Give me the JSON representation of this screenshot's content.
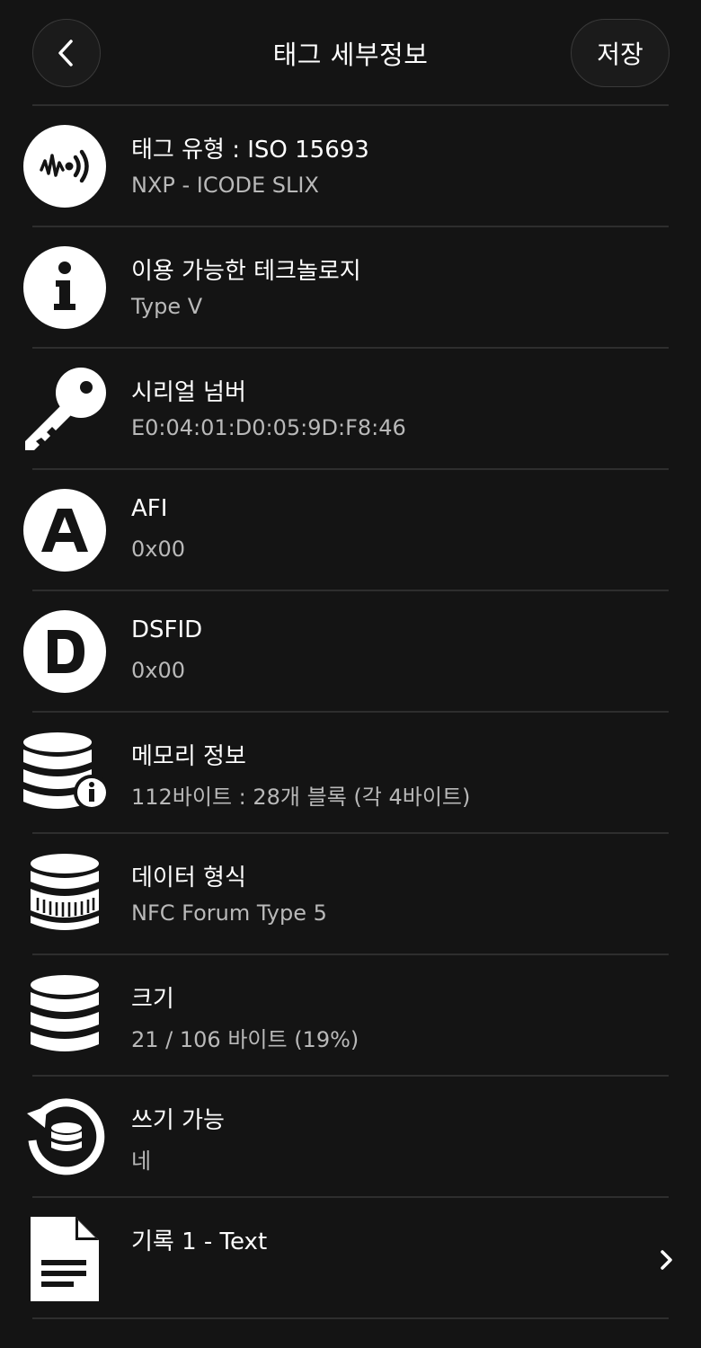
{
  "header": {
    "title": "태그 세부정보",
    "save_label": "저장",
    "back_icon": "chevron-left-icon"
  },
  "rows": [
    {
      "icon": "nfc-wave-icon",
      "title": "태그 유형 : ISO 15693",
      "value": "NXP - ICODE SLIX"
    },
    {
      "icon": "info-icon",
      "title": "이용 가능한 테크놀로지",
      "value": "Type V"
    },
    {
      "icon": "key-icon",
      "title": "시리얼 넘버",
      "value": "E0:04:01:D0:05:9D:F8:46"
    },
    {
      "icon": "letter-a-icon",
      "title": "AFI",
      "value": "0x00"
    },
    {
      "icon": "letter-d-icon",
      "title": "DSFID",
      "value": "0x00"
    },
    {
      "icon": "database-info-icon",
      "title": "메모리 정보",
      "value": "112바이트 : 28개 블록 (각 4바이트)"
    },
    {
      "icon": "database-format-icon",
      "title": "데이터 형식",
      "value": "NFC Forum Type 5"
    },
    {
      "icon": "database-icon",
      "title": "크기",
      "value": "21 / 106 바이트 (19%)"
    },
    {
      "icon": "rewrite-database-icon",
      "title": "쓰기 가능",
      "value": "네"
    },
    {
      "icon": "document-icon",
      "title": "기록 1 - Text",
      "value": "",
      "chevron_icon": "chevron-right-icon"
    }
  ],
  "colors": {
    "background": "#141414",
    "text_primary": "#ffffff",
    "text_secondary": "#b9b9b9",
    "divider": "#2e2e2e"
  }
}
